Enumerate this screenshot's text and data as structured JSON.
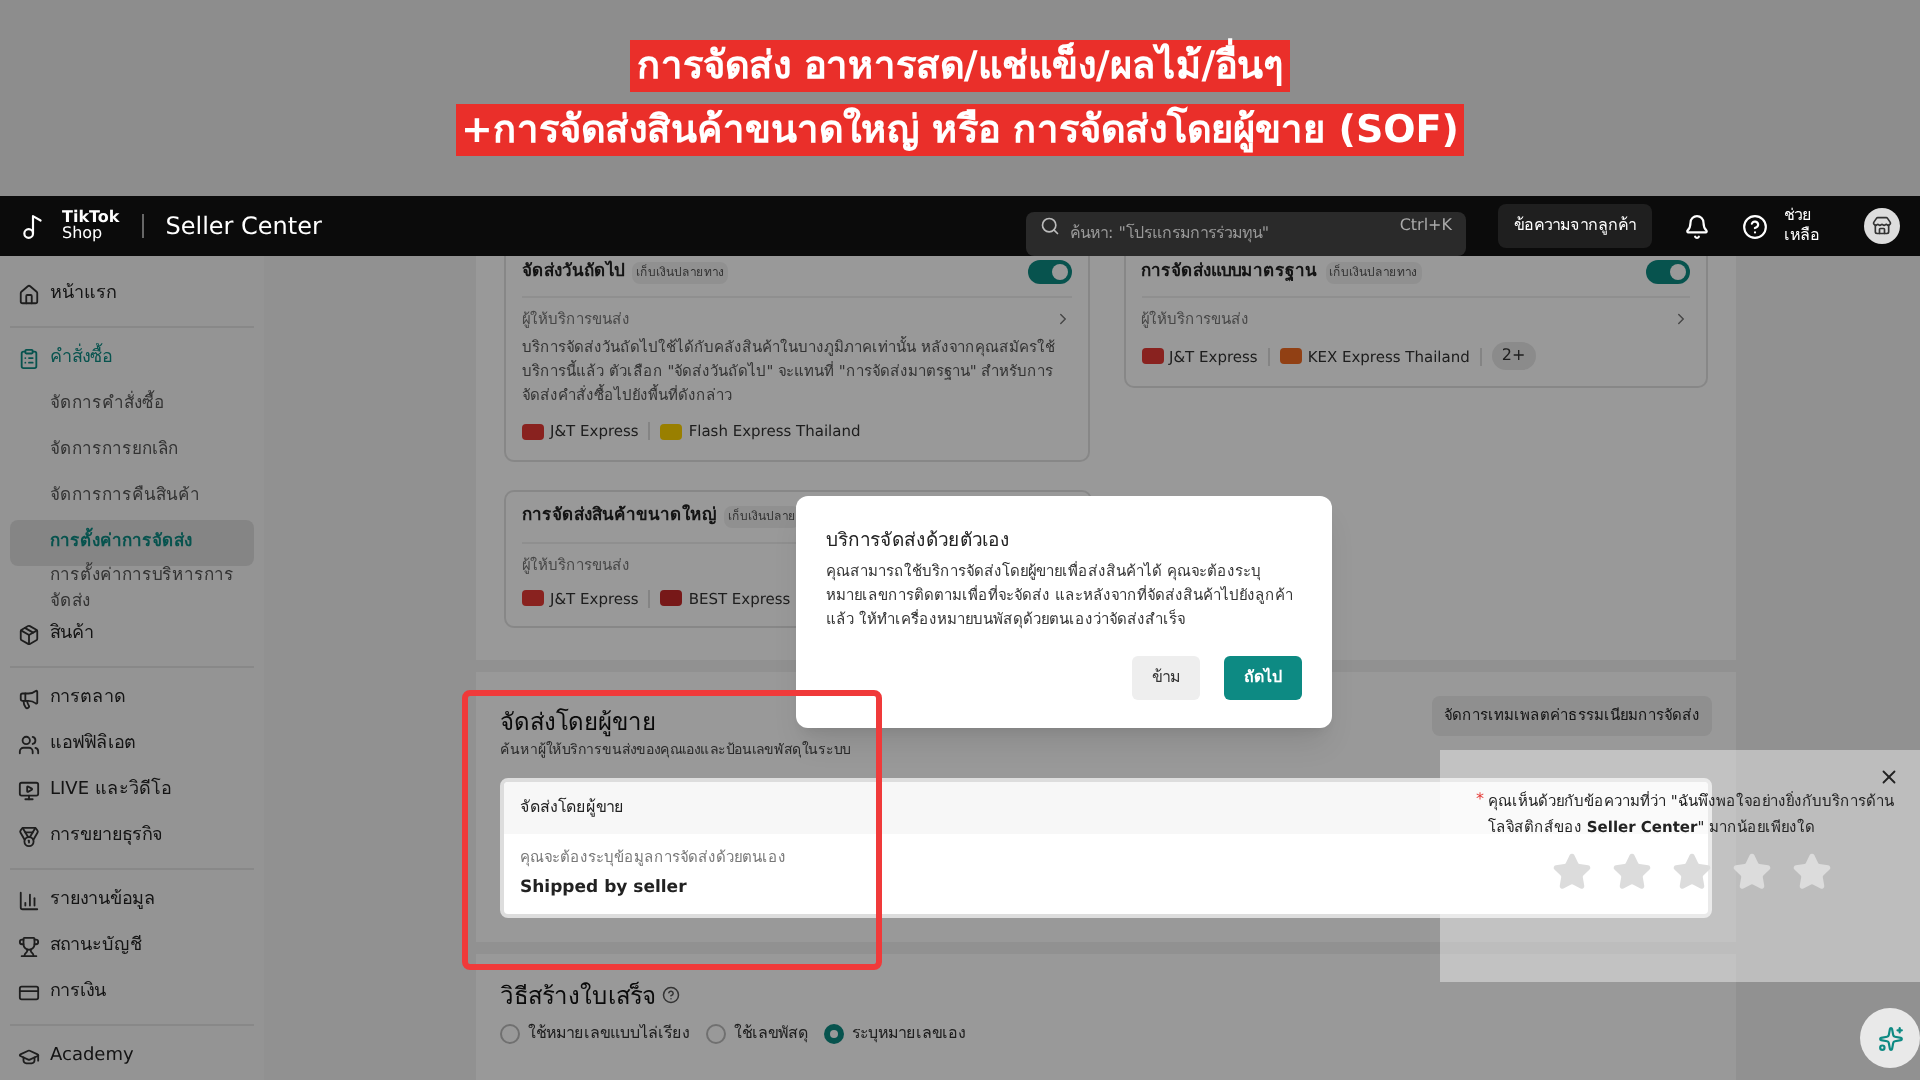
{
  "banner": {
    "lines": [
      "การจัดส่ง อาหารสด/แช่แข็ง/ผลไม้/อื่นๆ",
      "+การจัดส่งสินค้าขนาดใหญ่ หรือ การจัดส่งโดยผู้ขาย (SOF)"
    ]
  },
  "header": {
    "logo_top": "TikTok",
    "logo_bottom": "Shop",
    "app_name": "Seller Center",
    "search": {
      "placeholder": "ค้นหา: \"โปรแกรมการร่วมทุน\"",
      "shortcut": "Ctrl+K"
    },
    "messages_button": "ข้อความจากลูกค้า",
    "help_lines": [
      "ช่วย",
      "เหลือ"
    ]
  },
  "sidebar": {
    "sections": [
      {
        "items": [
          {
            "label": "หน้าแรก",
            "selected": false
          }
        ]
      },
      {
        "items": [
          {
            "label": "คำสั่งซื้อ",
            "selected": false,
            "children": [
              {
                "label": "จัดการคำสั่งซื้อ",
                "selected": false
              },
              {
                "label": "จัดการการยกเลิก",
                "selected": false
              },
              {
                "label": "จัดการการคืนสินค้า",
                "selected": false
              },
              {
                "label": "การตั้งค่าการจัดส่ง",
                "selected": true
              },
              {
                "label": "การตั้งค่าการบริหารการจัดส่ง",
                "selected": false
              }
            ]
          },
          {
            "label": "สินค้า",
            "selected": false
          }
        ]
      },
      {
        "items": [
          {
            "label": "การตลาด",
            "selected": false
          },
          {
            "label": "แอฟฟิลิเอต",
            "selected": false
          },
          {
            "label": "LIVE และวิดีโอ",
            "selected": false
          },
          {
            "label": "การขยายธุรกิจ",
            "selected": false
          }
        ]
      },
      {
        "items": [
          {
            "label": "รายงานข้อมูล",
            "selected": false
          },
          {
            "label": "สถานะบัญชี",
            "selected": false
          },
          {
            "label": "การเงิน",
            "selected": false
          }
        ]
      },
      {
        "items": [
          {
            "label": "Academy",
            "selected": false
          }
        ]
      }
    ]
  },
  "cards": [
    {
      "title": "จัดส่งวันถัดไป",
      "tag": "เก็บเงินปลายทาง",
      "on": true,
      "provider_label": "ผู้ให้บริการขนส่ง",
      "description": "บริการจัดส่งวันถัดไปใช้ได้กับคลังสินค้าในบางภูมิภาคเท่านั้น หลังจากคุณสมัครใช้บริการนี้แล้ว ตัวเลือก \"จัดส่งวันถัดไป\" จะแทนที่ \"การจัดส่งมาตรฐาน\" สำหรับการจัดส่งคำสั่งซื้อไปยังพื้นที่ดังกล่าว",
      "carriers": [
        {
          "name": "J&T Express",
          "color": "#89221f"
        },
        {
          "name": "Flash Express Thailand",
          "color": "#997f00"
        }
      ]
    },
    {
      "title": "การจัดส่งแบบมาตรฐาน",
      "tag": "เก็บเงินปลายทาง",
      "on": true,
      "provider_label": "ผู้ให้บริการขนส่ง",
      "carriers": [
        {
          "name": "J&T Express",
          "color": "#89221f"
        },
        {
          "name": "KEX Express Thailand",
          "color": "#914014"
        }
      ],
      "more": "2+"
    },
    {
      "title": "การจัดส่งสินค้าขนาดใหญ่",
      "tag": "เก็บเงินปลาย",
      "provider_label": "ผู้ให้บริการขนส่ง",
      "carriers": [
        {
          "name": "J&T Express",
          "color": "#89221f"
        },
        {
          "name": "BEST Express",
          "color": "#771818"
        }
      ]
    }
  ],
  "seller_section": {
    "title": "จัดส่งโดยผู้ขาย",
    "subtitle": "ค้นหาผู้ให้บริการขนส่งของคุณเองและป้อนเลขพัสดุในระบบ",
    "template_button": "จัดการเทมเพลตค่าธรรมเนียมการจัดส่ง",
    "card_header": "จัดส่งโดยผู้ขาย",
    "note": "คุณจะต้องระบุข้อมูลการจัดส่งด้วยตนเอง",
    "method": "Shipped by seller"
  },
  "receipt_section": {
    "title": "วิธีสร้างใบเสร็จ",
    "options": [
      {
        "label": "ใช้หมายเลขแบบไล่เรียง",
        "selected": false
      },
      {
        "label": "ใช้เลขพัสดุ",
        "selected": false
      },
      {
        "label": "ระบุหมายเลขเอง",
        "selected": true
      }
    ]
  },
  "modal": {
    "title": "บริการจัดส่งด้วยตัวเอง",
    "body": "คุณสามารถใช้บริการจัดส่งโดยผู้ขายเพื่อส่งสินค้าได้ คุณจะต้องระบุหมายเลขการติดตามเพื่อที่จะจัดส่ง และหลังจากที่จัดส่งสินค้าไปยังลูกค้าแล้ว ให้ทำเครื่องหมายบนพัสดุด้วยตนเองว่าจัดส่งสำเร็จ",
    "buttons": [
      "ข้าม",
      "ถัดไป"
    ]
  },
  "feedback": {
    "required_mark": "*",
    "question": "คุณเห็นด้วยกับข้อความที่ว่า \"ฉันพึงพอใจอย่างยิ่งกับบริการด้านโลจิสติกส์ของ **Seller Center**\" มากน้อยเพียงใด",
    "stars": 0
  }
}
